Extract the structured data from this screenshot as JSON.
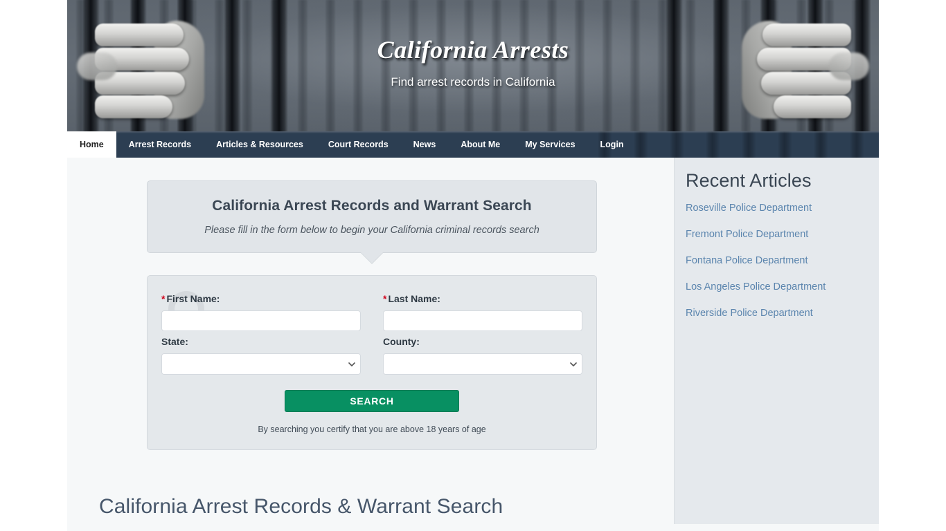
{
  "banner": {
    "title": "California Arrests",
    "tagline": "Find arrest records in California"
  },
  "nav": {
    "items": [
      {
        "label": "Home",
        "active": true
      },
      {
        "label": "Arrest Records",
        "active": false
      },
      {
        "label": "Articles & Resources",
        "active": false
      },
      {
        "label": "Court Records",
        "active": false
      },
      {
        "label": "News",
        "active": false
      },
      {
        "label": "About Me",
        "active": false
      },
      {
        "label": "My Services",
        "active": false
      },
      {
        "label": "Login",
        "active": false
      }
    ]
  },
  "callout": {
    "heading": "California Arrest Records and Warrant Search",
    "subheading": "Please fill in the form below to begin your California criminal records search"
  },
  "form": {
    "first_name": {
      "label": "First Name:",
      "required_marker": "*",
      "value": "",
      "placeholder": ""
    },
    "last_name": {
      "label": "Last Name:",
      "required_marker": "*",
      "value": "",
      "placeholder": ""
    },
    "state": {
      "label": "State:",
      "selected": "",
      "options": [
        ""
      ]
    },
    "county": {
      "label": "County:",
      "selected": "",
      "options": [
        ""
      ]
    },
    "search_button": "SEARCH",
    "disclaimer": "By searching you certify that you are above 18 years of age"
  },
  "main": {
    "page_heading": "California Arrest Records & Warrant Search"
  },
  "sidebar": {
    "title": "Recent Articles",
    "links": [
      {
        "label": "Roseville Police Department"
      },
      {
        "label": "Fremont Police Department"
      },
      {
        "label": "Fontana Police Department"
      },
      {
        "label": "Los Angeles Police Department"
      },
      {
        "label": "Riverside Police Department"
      }
    ]
  },
  "colors": {
    "nav_bar": "#2c3e52",
    "search_button_green": "#089062",
    "link_blue": "#5b85ae",
    "heading_slate": "#46566a",
    "panel_gray": "#e4e8eb",
    "sidebar_gray": "#e5e9ed",
    "required_red": "#d0021b"
  }
}
